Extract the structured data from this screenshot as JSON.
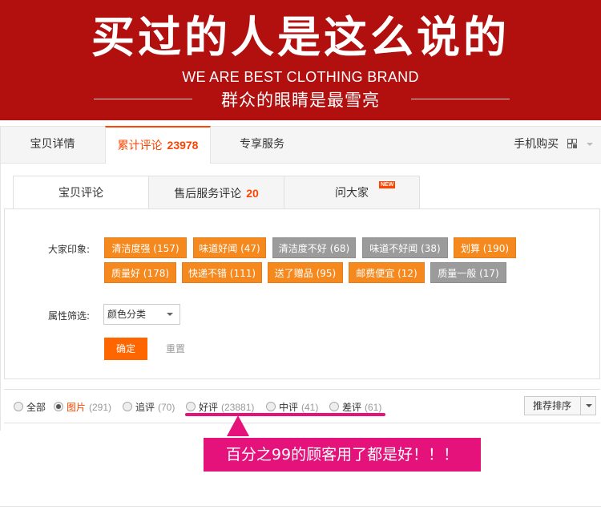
{
  "banner": {
    "title": "买过的人是这么说的",
    "subtitle": "WE ARE BEST CLOTHING BRAND",
    "slogan": "群众的眼睛是最雪亮"
  },
  "top_tabs": [
    {
      "label": "宝贝详情"
    },
    {
      "label": "累计评论",
      "count": "23978"
    },
    {
      "label": "专享服务"
    }
  ],
  "mobile_buy": "手机购买",
  "sub_tabs": [
    {
      "label": "宝贝评论"
    },
    {
      "label": "售后服务评论",
      "count": "20"
    },
    {
      "label": "问大家",
      "badge": "NEW"
    }
  ],
  "impression": {
    "label": "大家印象:",
    "tags": [
      {
        "text": "清洁度强 (157)",
        "color": "orange"
      },
      {
        "text": "味道好闻 (47)",
        "color": "orange"
      },
      {
        "text": "清洁度不好 (68)",
        "color": "gray"
      },
      {
        "text": "味道不好闻 (38)",
        "color": "gray"
      },
      {
        "text": "划算 (190)",
        "color": "orange"
      },
      {
        "text": "质量好 (178)",
        "color": "orange"
      },
      {
        "text": "快递不错 (111)",
        "color": "orange"
      },
      {
        "text": "送了赠品 (95)",
        "color": "orange"
      },
      {
        "text": "邮费便宜 (12)",
        "color": "orange"
      },
      {
        "text": "质量一般 (17)",
        "color": "gray"
      }
    ]
  },
  "attribute_filter": {
    "label": "属性筛选:",
    "select_value": "颜色分类"
  },
  "buttons": {
    "confirm": "确定",
    "reset": "重置"
  },
  "filters": [
    {
      "label": "全部",
      "count": "",
      "checked": false
    },
    {
      "label": "图片",
      "count": "(291)",
      "checked": true
    },
    {
      "label": "追评",
      "count": "(70)",
      "checked": false
    },
    {
      "label": "好评",
      "count": "(23881)",
      "checked": false
    },
    {
      "label": "中评",
      "count": "(41)",
      "checked": false
    },
    {
      "label": "差评",
      "count": "(61)",
      "checked": false
    }
  ],
  "sort": {
    "label": "推荐排序"
  },
  "callout": "百分之99的顾客用了都是好！！！",
  "colors": {
    "banner": "#b20f0f",
    "accent": "#f40",
    "tag_orange": "#f6891e",
    "tag_gray": "#9b9b9b",
    "highlight": "#e4127a"
  }
}
